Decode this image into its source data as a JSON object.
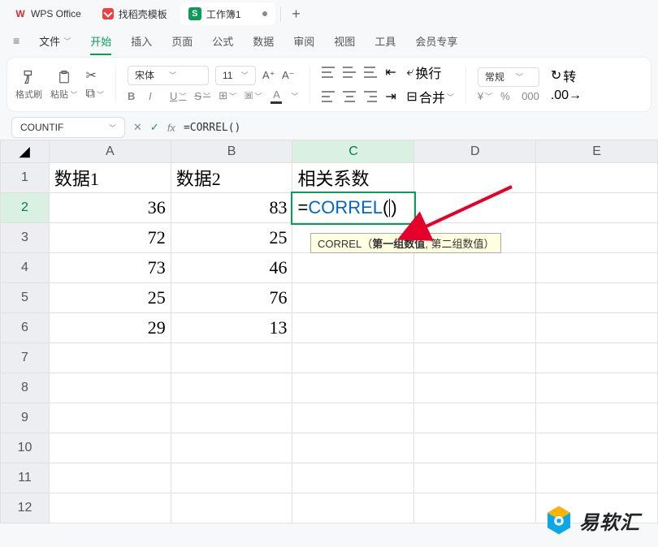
{
  "tabs": {
    "office": "WPS Office",
    "templates": "找稻壳模板",
    "workbook": "工作簿1"
  },
  "add_tab": "+",
  "menu": {
    "file": "文件",
    "items": [
      "开始",
      "插入",
      "页面",
      "公式",
      "数据",
      "审阅",
      "视图",
      "工具",
      "会员专享"
    ],
    "active_index": 0
  },
  "toolbar": {
    "format_painter": "格式刷",
    "paste": "粘贴",
    "font_name": "宋体",
    "font_size": "11",
    "increase_font": "A⁺",
    "decrease_font": "A⁻",
    "bold": "B",
    "italic": "I",
    "underline": "U",
    "strike": "S",
    "wrap": "换行",
    "merge": "合并",
    "number_format": "常规",
    "currency": "¥",
    "percent": "%",
    "thousand": "000",
    "rotate": "转"
  },
  "formula_bar": {
    "name_box": "COUNTIF",
    "formula": "=CORREL()"
  },
  "columns": [
    "A",
    "B",
    "C",
    "D",
    "E"
  ],
  "active_col_index": 2,
  "active_row_index": 1,
  "rows": [
    1,
    2,
    3,
    4,
    5,
    6,
    7,
    8,
    9,
    10,
    11,
    12
  ],
  "cells": {
    "A1": "数据1",
    "B1": "数据2",
    "C1": "相关系数",
    "A2": "36",
    "B2": "83",
    "A3": "72",
    "B3": "25",
    "A4": "73",
    "B4": "46",
    "A5": "25",
    "B5": "76",
    "A6": "29",
    "B6": "13"
  },
  "editing_cell": {
    "prefix": "=",
    "fn": "CORREL",
    "open": "(",
    "close": ")"
  },
  "tooltip": {
    "fn": "CORREL",
    "open": "（",
    "arg1": "第一组数值",
    "sep": ", ",
    "arg2": "第二组数值",
    "close": "）"
  },
  "chart_data": {
    "type": "table",
    "columns": [
      "数据1",
      "数据2"
    ],
    "rows": [
      [
        36,
        83
      ],
      [
        72,
        25
      ],
      [
        73,
        46
      ],
      [
        25,
        76
      ],
      [
        29,
        13
      ]
    ],
    "formula": "=CORREL()"
  },
  "logo_text": "易软汇"
}
